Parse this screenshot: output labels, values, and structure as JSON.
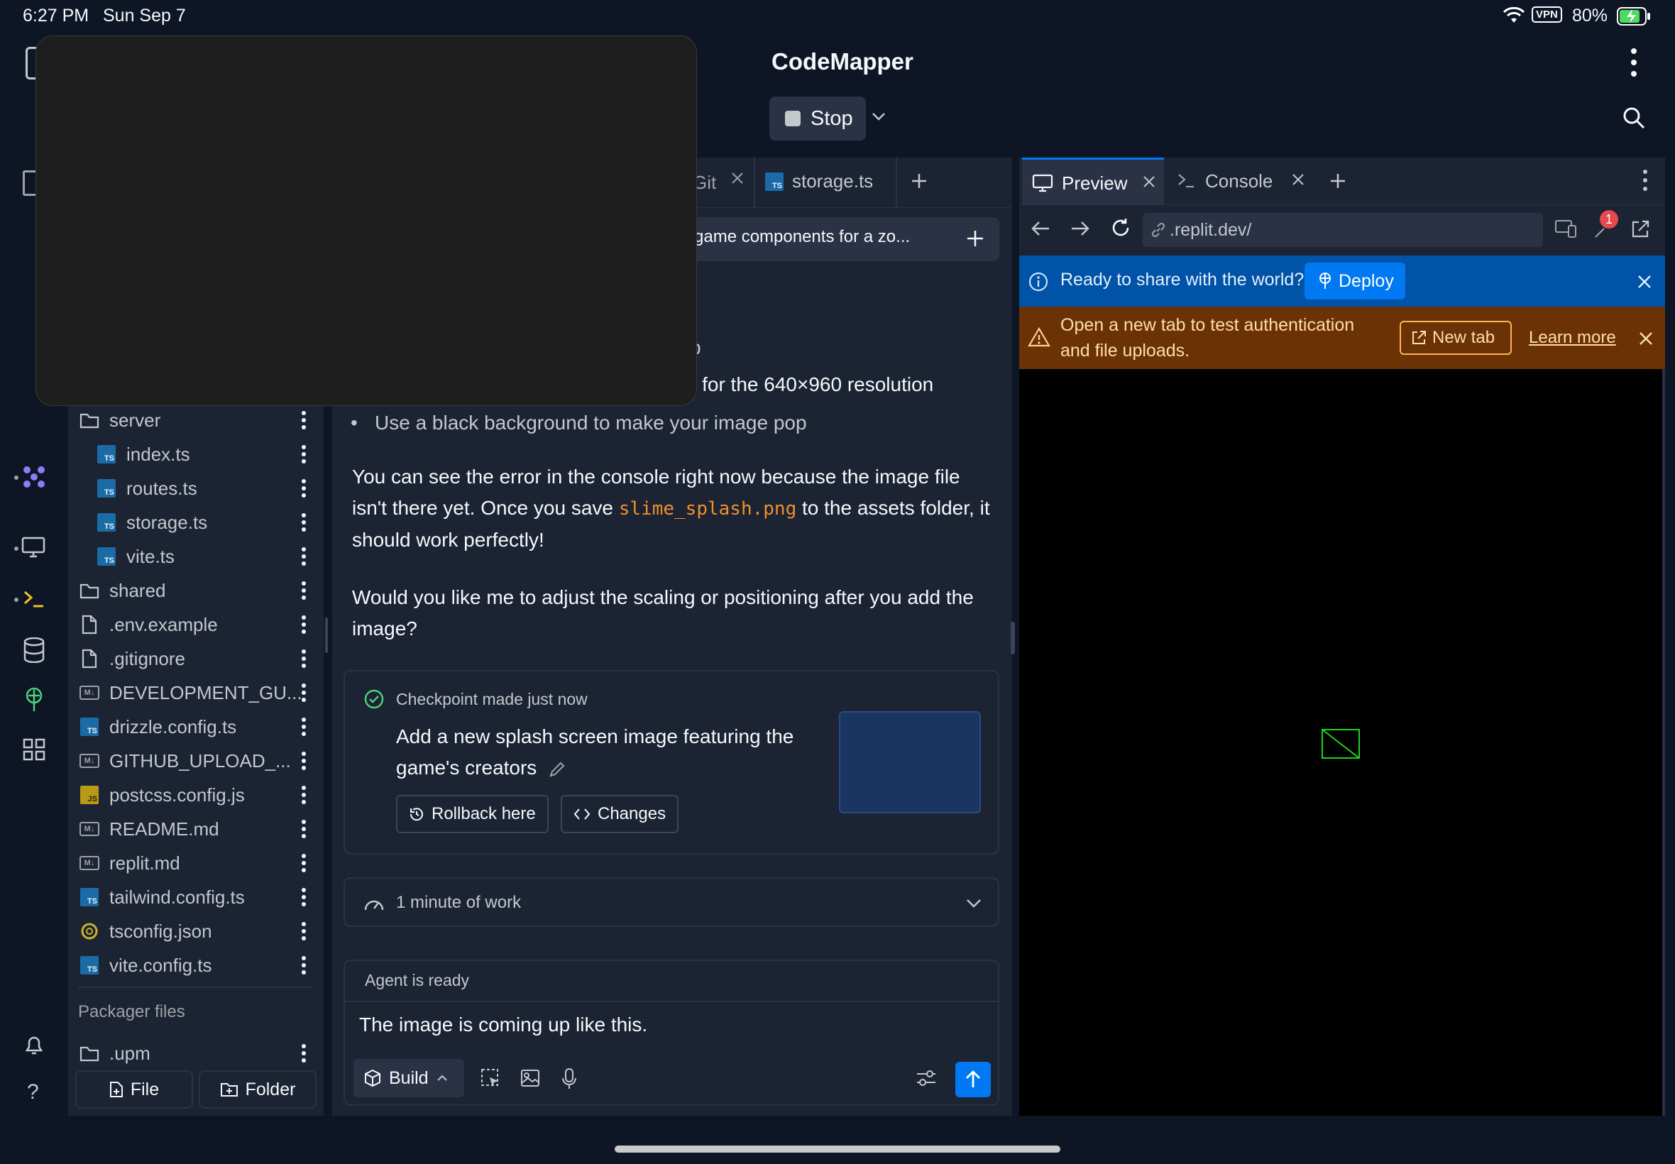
{
  "status_bar": {
    "time": "6:27 PM",
    "date": "Sun Sep 7",
    "vpn": "VPN",
    "battery": "80%"
  },
  "app": {
    "title": "CodeMapper",
    "stop_label": "Stop"
  },
  "editor_tabs": [
    {
      "label": "Git"
    },
    {
      "label": "storage.ts"
    }
  ],
  "thread_title": "game components for a zo...",
  "chat": {
    "bullets": [
      "p",
      ") for the 640×960 resolution",
      "Use a black background to make your image pop"
    ],
    "para1_a": "You can see the error in the console right now because the image file isn't there yet. Once you save",
    "para1_code": "slime_splash.png",
    "para1_b": "to the assets folder, it should work perfectly!",
    "para2": "Would you like me to adjust the scaling or positioning after you add the image?"
  },
  "checkpoint": {
    "header": "Checkpoint made just now",
    "title": "Add a new splash screen image featuring the game's creators",
    "rollback_label": "Rollback here",
    "changes_label": "Changes"
  },
  "work": {
    "label": "1 minute of work"
  },
  "agent": {
    "status": "Agent is ready",
    "input_value": "The image is coming up like this.",
    "mode_label": "Build"
  },
  "file_tree": {
    "items": [
      {
        "name": "server",
        "type": "folder",
        "indent": 0
      },
      {
        "name": "index.ts",
        "type": "ts",
        "indent": 1
      },
      {
        "name": "routes.ts",
        "type": "ts",
        "indent": 1
      },
      {
        "name": "storage.ts",
        "type": "ts",
        "indent": 1
      },
      {
        "name": "vite.ts",
        "type": "ts",
        "indent": 1
      },
      {
        "name": "shared",
        "type": "folder",
        "indent": 0
      },
      {
        "name": ".env.example",
        "type": "file",
        "indent": 0
      },
      {
        "name": ".gitignore",
        "type": "file",
        "indent": 0
      },
      {
        "name": "DEVELOPMENT_GU...",
        "type": "md",
        "indent": 0
      },
      {
        "name": "drizzle.config.ts",
        "type": "ts",
        "indent": 0
      },
      {
        "name": "GITHUB_UPLOAD_...",
        "type": "md",
        "indent": 0
      },
      {
        "name": "postcss.config.js",
        "type": "js",
        "indent": 0
      },
      {
        "name": "README.md",
        "type": "md",
        "indent": 0
      },
      {
        "name": "replit.md",
        "type": "md",
        "indent": 0
      },
      {
        "name": "tailwind.config.ts",
        "type": "ts",
        "indent": 0
      },
      {
        "name": "tsconfig.json",
        "type": "json",
        "indent": 0
      },
      {
        "name": "vite.config.ts",
        "type": "ts",
        "indent": 0
      }
    ],
    "packager_label": "Packager files",
    "upm": ".upm",
    "file_button": "File",
    "folder_button": "Folder"
  },
  "preview": {
    "tabs": [
      {
        "label": "Preview"
      },
      {
        "label": "Console"
      }
    ],
    "url": ".replit.dev/",
    "badge_count": "1",
    "deploy_msg": "Ready to share with the world?",
    "deploy_label": "Deploy",
    "warning_msg": "Open a new tab to test authentication and file uploads.",
    "new_tab_label": "New tab",
    "learn_more_label": "Learn more"
  },
  "colors": {
    "bg": "#0e1525",
    "panel": "#1c2333",
    "accent_blue": "#0053a6",
    "warning_bg": "#6b3305",
    "code_orange": "#f0902a"
  }
}
